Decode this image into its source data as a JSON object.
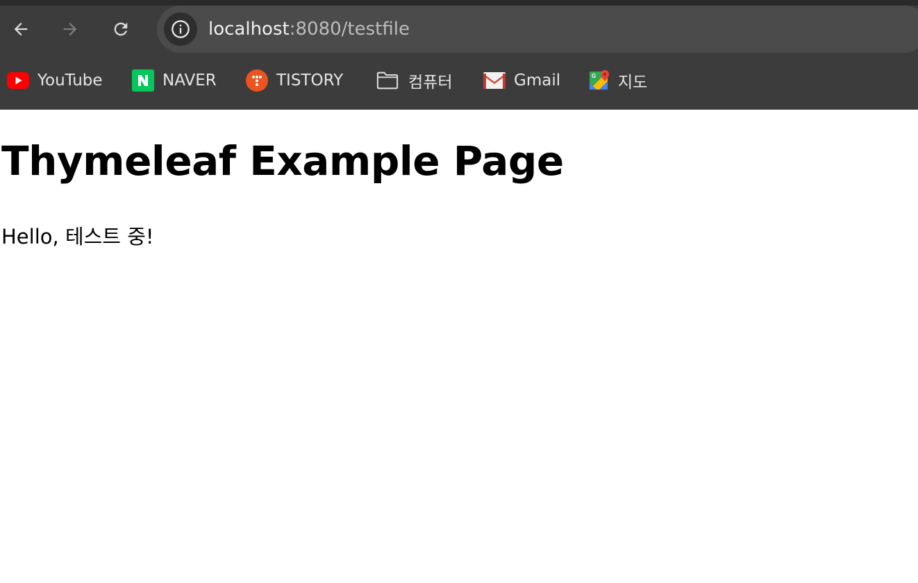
{
  "browser": {
    "address_bar": {
      "host": "localhost",
      "path": ":8080/testfile"
    },
    "toolbar": {
      "back_icon": "arrow-left-icon",
      "forward_icon": "arrow-right-icon",
      "reload_icon": "reload-icon",
      "site_info_icon": "info-icon"
    },
    "bookmarks": [
      {
        "label": "YouTube",
        "icon": "youtube-icon"
      },
      {
        "label": "NAVER",
        "icon": "naver-icon"
      },
      {
        "label": "TISTORY",
        "icon": "tistory-icon"
      },
      {
        "label": "컴퓨터",
        "icon": "folder-icon"
      },
      {
        "label": "Gmail",
        "icon": "gmail-icon"
      },
      {
        "label": "지도",
        "icon": "maps-icon"
      }
    ],
    "colors": {
      "toolbar_bg": "#3c3c3c",
      "omnibox_bg": "#4b4b4b",
      "youtube_red": "#ff0000",
      "naver_green": "#03c75a",
      "tistory_orange": "#eb531f"
    }
  },
  "page": {
    "heading": "Thymeleaf Example Page",
    "greeting": "Hello, 테스트 중!"
  }
}
